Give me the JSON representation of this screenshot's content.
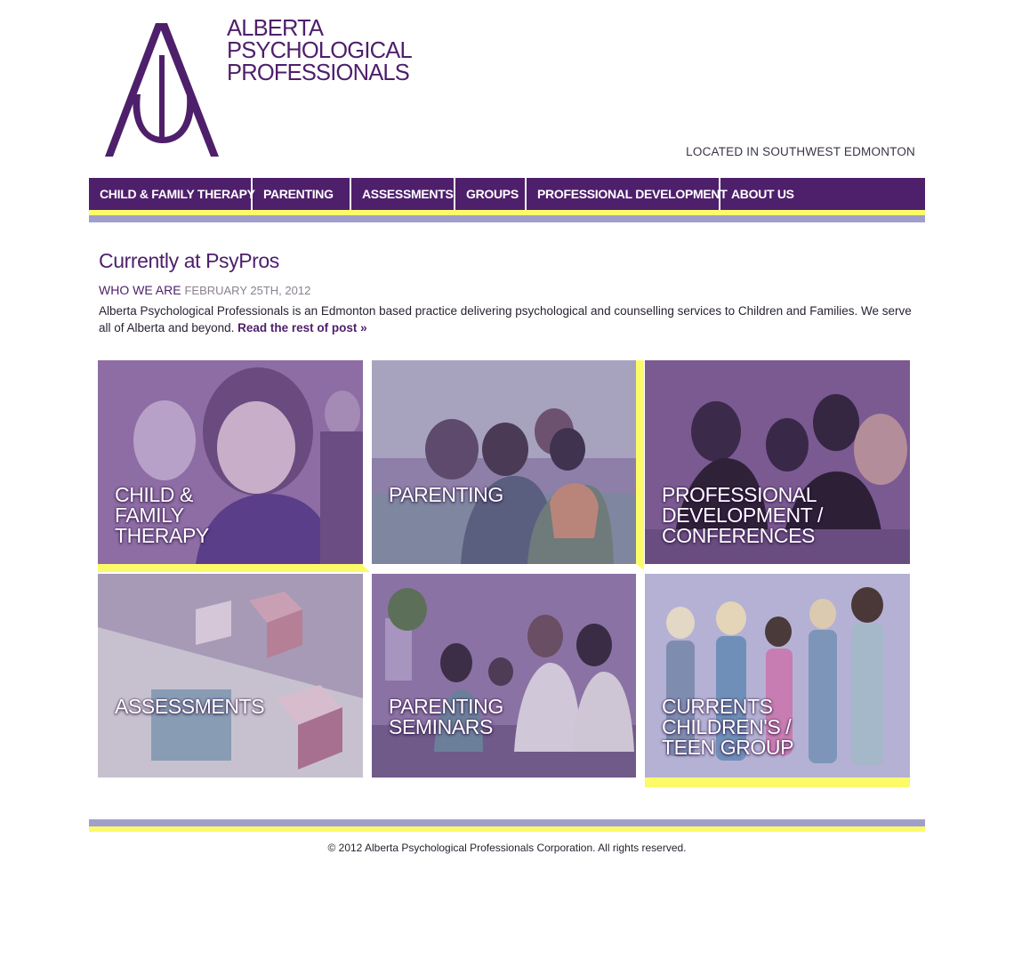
{
  "header": {
    "logo_lines": [
      "ALBERTA",
      "PSYCHOLOGICAL",
      "PROFESSIONALS"
    ],
    "location": "LOCATED IN SOUTHWEST EDMONTON"
  },
  "nav": {
    "items": [
      {
        "label": "CHILD & FAMILY THERAPY"
      },
      {
        "label": "PARENTING"
      },
      {
        "label": "ASSESSMENTS"
      },
      {
        "label": "GROUPS"
      },
      {
        "label": "PROFESSIONAL DEVELOPMENT"
      },
      {
        "label": "ABOUT US"
      }
    ]
  },
  "intro": {
    "section_title": "Currently at PsyPros",
    "post_title": "WHO WE ARE",
    "post_date": "FEBRUARY 25TH, 2012",
    "post_body": "Alberta Psychological Professionals is an Edmonton based practice delivering psychological and counselling services to Children and Families. We serve all of Alberta and beyond.",
    "read_more": "Read the rest of post »"
  },
  "tiles": [
    {
      "label": "CHILD &\nFAMILY\nTHERAPY"
    },
    {
      "label": "PARENTING"
    },
    {
      "label": "PROFESSIONAL\nDEVELOPMENT /\nCONFERENCES"
    },
    {
      "label": "ASSESSMENTS"
    },
    {
      "label": "PARENTING\nSEMINARS"
    },
    {
      "label": "CURRENTS\nCHILDREN'S /\nTEEN GROUP"
    }
  ],
  "footer": {
    "copyright": "© 2012 Alberta Psychological Professionals Corporation. All rights reserved."
  },
  "colors": {
    "brand_purple": "#4e1f6b",
    "accent_yellow": "#fbfb6a",
    "lavender": "#a09fcc"
  }
}
